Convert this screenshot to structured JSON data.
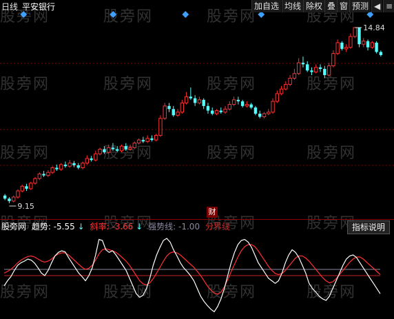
{
  "header": {
    "period": "日线",
    "stock_name": "平安银行",
    "toolbar": [
      "加自选",
      "均线",
      "除权",
      "叠",
      "窗",
      "预测"
    ]
  },
  "watermark": "股旁网",
  "price_labels": {
    "high": "14.84",
    "low": "9.15"
  },
  "event_badge": "财",
  "indicator": {
    "name": "股旁网",
    "trend_label": "趋势:",
    "trend_value": "-5.55",
    "slope_label": "斜率:",
    "slope_value": "-3.66",
    "strong_label": "强势线:",
    "strong_value": "-1.00",
    "boundary_label": "分界线",
    "explain_button": "指标说明"
  },
  "colors": {
    "up": "#ff3232",
    "down": "#54ffff",
    "trend_line": "#ffffff",
    "slope_line": "#ff3030",
    "strong_line": "#8a8aa0",
    "boundary_line": "#cc2222",
    "marker": "#3fa0ff"
  },
  "chart_data": [
    {
      "type": "candlestick",
      "title": "",
      "y_min": 9.15,
      "y_max": 14.84,
      "candles": [
        [
          9.4,
          9.3,
          9.45,
          9.25
        ],
        [
          9.3,
          9.22,
          9.35,
          9.15
        ],
        [
          9.22,
          9.35,
          9.4,
          9.18
        ],
        [
          9.35,
          9.55,
          9.6,
          9.3
        ],
        [
          9.55,
          9.7,
          9.75,
          9.5
        ],
        [
          9.7,
          9.62,
          9.78,
          9.55
        ],
        [
          9.62,
          9.8,
          9.85,
          9.58
        ],
        [
          9.8,
          9.95,
          10.0,
          9.75
        ],
        [
          9.95,
          10.1,
          10.15,
          9.9
        ],
        [
          10.1,
          10.05,
          10.2,
          10.0
        ],
        [
          10.05,
          10.15,
          10.22,
          10.0
        ],
        [
          10.15,
          10.3,
          10.35,
          10.1
        ],
        [
          10.3,
          10.25,
          10.4,
          10.2
        ],
        [
          10.25,
          10.4,
          10.45,
          10.2
        ],
        [
          10.4,
          10.35,
          10.5,
          10.3
        ],
        [
          10.35,
          10.45,
          10.55,
          10.3
        ],
        [
          10.45,
          10.38,
          10.52,
          10.32
        ],
        [
          10.38,
          10.3,
          10.45,
          10.25
        ],
        [
          10.3,
          10.45,
          10.5,
          10.25
        ],
        [
          10.45,
          10.6,
          10.7,
          10.4
        ],
        [
          10.6,
          10.55,
          10.68,
          10.5
        ],
        [
          10.55,
          10.75,
          10.85,
          10.5
        ],
        [
          10.75,
          10.9,
          10.95,
          10.7
        ],
        [
          10.9,
          10.8,
          11.0,
          10.75
        ],
        [
          10.8,
          10.95,
          11.05,
          10.75
        ],
        [
          10.95,
          10.9,
          11.1,
          10.85
        ],
        [
          10.9,
          10.85,
          11.0,
          10.8
        ],
        [
          10.85,
          11.0,
          11.05,
          10.8
        ],
        [
          11.0,
          10.9,
          11.1,
          10.85
        ],
        [
          10.9,
          10.95,
          11.05,
          10.85
        ],
        [
          10.95,
          11.1,
          11.15,
          10.9
        ],
        [
          11.1,
          11.2,
          11.25,
          11.05
        ],
        [
          11.2,
          11.15,
          11.3,
          11.1
        ],
        [
          11.15,
          11.25,
          11.35,
          11.1
        ],
        [
          11.25,
          11.2,
          11.35,
          11.15
        ],
        [
          11.2,
          11.35,
          11.4,
          11.15
        ],
        [
          11.35,
          11.9,
          12.0,
          11.3
        ],
        [
          11.9,
          12.3,
          12.4,
          11.85
        ],
        [
          12.3,
          12.2,
          12.4,
          12.1
        ],
        [
          12.2,
          12.0,
          12.3,
          11.95
        ],
        [
          12.0,
          12.1,
          12.2,
          11.95
        ],
        [
          12.1,
          12.4,
          12.5,
          12.05
        ],
        [
          12.4,
          12.6,
          12.75,
          12.35
        ],
        [
          12.6,
          12.55,
          12.9,
          12.5
        ],
        [
          12.55,
          12.4,
          12.65,
          12.3
        ],
        [
          12.4,
          12.5,
          12.6,
          12.35
        ],
        [
          12.5,
          12.3,
          12.55,
          12.2
        ],
        [
          12.3,
          12.15,
          12.4,
          12.05
        ],
        [
          12.15,
          12.05,
          12.25,
          12.0
        ],
        [
          12.05,
          12.15,
          12.2,
          12.0
        ],
        [
          12.15,
          12.1,
          12.25,
          12.05
        ],
        [
          12.1,
          12.2,
          12.3,
          12.05
        ],
        [
          12.2,
          12.35,
          12.45,
          12.15
        ],
        [
          12.35,
          12.5,
          12.6,
          12.3
        ],
        [
          12.5,
          12.45,
          12.6,
          12.35
        ],
        [
          12.45,
          12.3,
          12.5,
          12.25
        ],
        [
          12.3,
          12.35,
          12.45,
          12.25
        ],
        [
          12.35,
          12.25,
          12.4,
          12.2
        ],
        [
          12.25,
          12.05,
          12.3,
          12.0
        ],
        [
          12.05,
          11.95,
          12.15,
          11.9
        ],
        [
          11.95,
          12.05,
          12.1,
          11.9
        ],
        [
          12.05,
          12.1,
          12.2,
          12.0
        ],
        [
          12.1,
          12.45,
          12.55,
          12.05
        ],
        [
          12.45,
          12.7,
          12.8,
          12.4
        ],
        [
          12.7,
          12.85,
          12.95,
          12.65
        ],
        [
          12.85,
          13.0,
          13.1,
          12.8
        ],
        [
          13.0,
          13.2,
          13.3,
          12.95
        ],
        [
          13.2,
          13.35,
          13.5,
          13.15
        ],
        [
          13.35,
          13.7,
          13.85,
          13.3
        ],
        [
          13.7,
          13.65,
          13.9,
          13.55
        ],
        [
          13.65,
          13.45,
          13.75,
          13.4
        ],
        [
          13.45,
          13.4,
          13.55,
          13.3
        ],
        [
          13.4,
          13.55,
          13.65,
          13.35
        ],
        [
          13.55,
          13.5,
          13.65,
          13.4
        ],
        [
          13.5,
          13.3,
          13.6,
          13.2
        ],
        [
          13.3,
          13.6,
          13.7,
          13.25
        ],
        [
          13.6,
          14.0,
          14.1,
          13.55
        ],
        [
          14.0,
          14.35,
          14.45,
          13.95
        ],
        [
          14.35,
          14.15,
          14.4,
          14.1
        ],
        [
          14.15,
          14.2,
          14.3,
          14.05
        ],
        [
          14.2,
          14.55,
          14.65,
          14.15
        ],
        [
          14.55,
          14.84,
          14.84,
          14.5
        ],
        [
          14.84,
          14.3,
          14.84,
          14.2
        ],
        [
          14.3,
          14.4,
          14.5,
          14.2
        ],
        [
          14.4,
          14.2,
          14.45,
          14.1
        ],
        [
          14.2,
          14.35,
          14.4,
          14.15
        ],
        [
          14.35,
          14.05,
          14.4,
          14.0
        ],
        [
          14.05,
          13.95,
          14.1,
          13.9
        ]
      ]
    },
    {
      "type": "line",
      "title": "",
      "series": [
        {
          "name": "趋势",
          "values": [
            -40,
            -30,
            -22,
            -10,
            0,
            5,
            8,
            12,
            10,
            4,
            -5,
            -15,
            -20,
            -10,
            5,
            18,
            25,
            28,
            26,
            15,
            5,
            -5,
            -15,
            -22,
            -30,
            -20,
            -5,
            20,
            50,
            48,
            30,
            25,
            28,
            20,
            10,
            0,
            -10,
            -25,
            -40,
            -55,
            -62,
            -58,
            -45,
            -25,
            0,
            20,
            35,
            48,
            52,
            45,
            30,
            18,
            5,
            -5,
            -12,
            -20,
            -30,
            -45,
            -60,
            -70,
            -78,
            -85,
            -90,
            -80,
            -65,
            -45,
            -20,
            5,
            25,
            40,
            48,
            50,
            45,
            35,
            20,
            5,
            -5,
            -15,
            -25,
            -30,
            -35,
            -30,
            -15,
            5,
            20,
            30,
            25,
            15,
            0,
            -15,
            -35,
            -45,
            -52,
            -60,
            -65,
            -68,
            -60,
            -45,
            -30,
            -15,
            0,
            12,
            18,
            20,
            15,
            5,
            -5,
            -15,
            -25,
            -35,
            -45,
            -55
          ]
        },
        {
          "name": "斜率",
          "values": [
            -15,
            -12,
            -8,
            -2,
            5,
            10,
            14,
            17,
            18,
            16,
            12,
            8,
            6,
            8,
            12,
            18,
            22,
            24,
            24,
            20,
            14,
            8,
            2,
            -4,
            -8,
            -6,
            0,
            10,
            22,
            30,
            32,
            30,
            28,
            25,
            20,
            14,
            8,
            0,
            -10,
            -20,
            -30,
            -36,
            -38,
            -34,
            -26,
            -15,
            -4,
            8,
            18,
            24,
            26,
            24,
            20,
            14,
            8,
            2,
            -4,
            -12,
            -20,
            -30,
            -40,
            -48,
            -54,
            -56,
            -52,
            -42,
            -28,
            -12,
            2,
            16,
            28,
            36,
            40,
            40,
            36,
            28,
            18,
            8,
            -2,
            -10,
            -16,
            -18,
            -16,
            -10,
            -2,
            6,
            14,
            18,
            18,
            14,
            8,
            0,
            -8,
            -16,
            -24,
            -30,
            -34,
            -32,
            -26,
            -18,
            -10,
            -2,
            6,
            12,
            16,
            16,
            12,
            6,
            0,
            -6,
            -12,
            -18
          ]
        }
      ],
      "strong_line": -1.0,
      "boundary_line": 0
    }
  ]
}
